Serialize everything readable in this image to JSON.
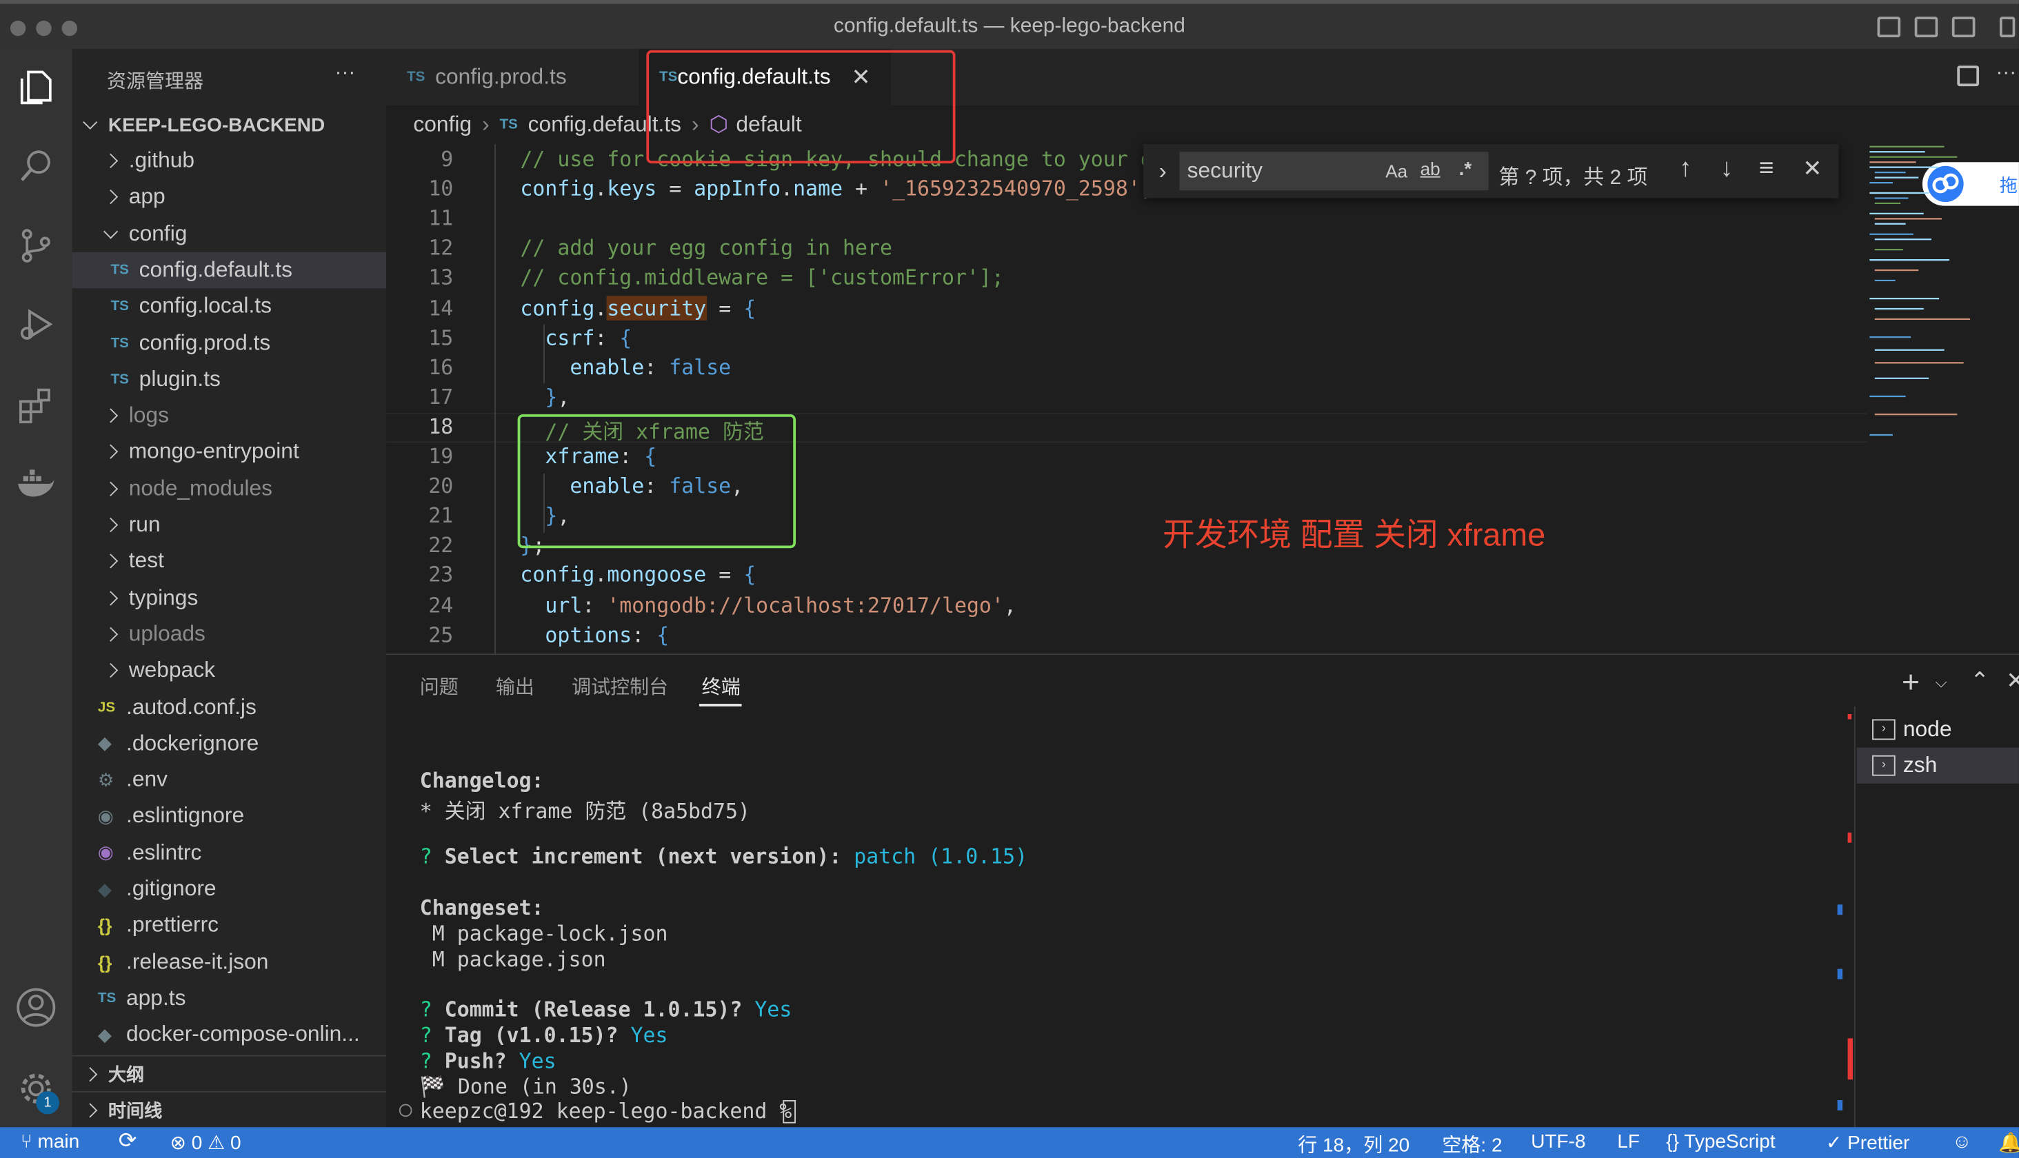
{
  "window": {
    "title": "config.default.ts — keep-lego-backend"
  },
  "sidebar": {
    "title": "资源管理器",
    "more": "···",
    "root": "KEEP-LEGO-BACKEND",
    "items": [
      {
        "label": ".github",
        "type": "folder"
      },
      {
        "label": "app",
        "type": "folder"
      },
      {
        "label": "config",
        "type": "folder-open"
      },
      {
        "label": "config.default.ts",
        "type": "ts"
      },
      {
        "label": "config.local.ts",
        "type": "ts"
      },
      {
        "label": "config.prod.ts",
        "type": "ts"
      },
      {
        "label": "plugin.ts",
        "type": "ts"
      },
      {
        "label": "logs",
        "type": "folder"
      },
      {
        "label": "mongo-entrypoint",
        "type": "folder"
      },
      {
        "label": "node_modules",
        "type": "folder"
      },
      {
        "label": "run",
        "type": "folder"
      },
      {
        "label": "test",
        "type": "folder"
      },
      {
        "label": "typings",
        "type": "folder"
      },
      {
        "label": "uploads",
        "type": "folder"
      },
      {
        "label": "webpack",
        "type": "folder"
      },
      {
        "label": ".autod.conf.js",
        "type": "js"
      },
      {
        "label": ".dockerignore",
        "type": "docker"
      },
      {
        "label": ".env",
        "type": "gear"
      },
      {
        "label": ".eslintignore",
        "type": "eslint-ignore"
      },
      {
        "label": ".eslintrc",
        "type": "eslint"
      },
      {
        "label": ".gitignore",
        "type": "git"
      },
      {
        "label": ".prettierrc",
        "type": "json"
      },
      {
        "label": ".release-it.json",
        "type": "json"
      },
      {
        "label": "app.ts",
        "type": "ts"
      },
      {
        "label": "docker-compose-onlin...",
        "type": "docker"
      }
    ],
    "outline": "大纲",
    "timeline": "时间线"
  },
  "tabs": [
    {
      "label": "config.prod.ts",
      "badge": "TS",
      "active": false
    },
    {
      "label": "config.default.ts",
      "badge": "TS",
      "active": true
    }
  ],
  "breadcrumb": {
    "folder": "config",
    "file": "config.default.ts",
    "symbol": "default",
    "badge": "TS"
  },
  "find": {
    "query": "security",
    "opt_case": "Aa",
    "opt_word": "ab",
    "opt_regex": ".*",
    "result": "第 ? 项，共 2 项"
  },
  "code": {
    "lines": [
      {
        "n": "9",
        "segs": [
          {
            "t": "// use for cookie sign key, should change to your own",
            "c": "c"
          }
        ]
      },
      {
        "n": "10",
        "segs": [
          {
            "t": "config",
            "c": "v"
          },
          {
            "t": ".",
            "c": "p"
          },
          {
            "t": "keys",
            "c": "v"
          },
          {
            "t": " = ",
            "c": "p"
          },
          {
            "t": "appInfo",
            "c": "v"
          },
          {
            "t": ".",
            "c": "p"
          },
          {
            "t": "name",
            "c": "v"
          },
          {
            "t": " + ",
            "c": "p"
          },
          {
            "t": "'_1659232540970_2598'",
            "c": "s"
          },
          {
            "t": ";",
            "c": "p"
          }
        ]
      },
      {
        "n": "11",
        "segs": []
      },
      {
        "n": "12",
        "segs": [
          {
            "t": "// add your egg config in here",
            "c": "c"
          }
        ]
      },
      {
        "n": "13",
        "segs": [
          {
            "t": "// config.middleware = ['customError'];",
            "c": "c"
          }
        ]
      },
      {
        "n": "14",
        "segs": [
          {
            "t": "config",
            "c": "v"
          },
          {
            "t": ".",
            "c": "p"
          },
          {
            "t": "security",
            "c": "v hl"
          },
          {
            "t": " = ",
            "c": "p"
          },
          {
            "t": "{",
            "c": "k"
          }
        ]
      },
      {
        "n": "15",
        "segs": [
          {
            "t": "  csrf",
            "c": "v"
          },
          {
            "t": ": ",
            "c": "p"
          },
          {
            "t": "{",
            "c": "k"
          }
        ]
      },
      {
        "n": "16",
        "segs": [
          {
            "t": "    enable",
            "c": "v"
          },
          {
            "t": ": ",
            "c": "p"
          },
          {
            "t": "false",
            "c": "k"
          }
        ]
      },
      {
        "n": "17",
        "segs": [
          {
            "t": "  }",
            "c": "k"
          },
          {
            "t": ",",
            "c": "p"
          }
        ]
      },
      {
        "n": "18",
        "segs": [
          {
            "t": "  // 关闭 xframe 防范",
            "c": "c"
          }
        ]
      },
      {
        "n": "19",
        "segs": [
          {
            "t": "  xframe",
            "c": "v"
          },
          {
            "t": ": ",
            "c": "p"
          },
          {
            "t": "{",
            "c": "k"
          }
        ]
      },
      {
        "n": "20",
        "segs": [
          {
            "t": "    enable",
            "c": "v"
          },
          {
            "t": ": ",
            "c": "p"
          },
          {
            "t": "false",
            "c": "k"
          },
          {
            "t": ",",
            "c": "p"
          }
        ]
      },
      {
        "n": "21",
        "segs": [
          {
            "t": "  }",
            "c": "k"
          },
          {
            "t": ",",
            "c": "p"
          }
        ]
      },
      {
        "n": "22",
        "segs": [
          {
            "t": "}",
            "c": "k"
          },
          {
            "t": ";",
            "c": "p"
          }
        ]
      },
      {
        "n": "23",
        "segs": [
          {
            "t": "config",
            "c": "v"
          },
          {
            "t": ".",
            "c": "p"
          },
          {
            "t": "mongoose",
            "c": "v"
          },
          {
            "t": " = ",
            "c": "p"
          },
          {
            "t": "{",
            "c": "k"
          }
        ]
      },
      {
        "n": "24",
        "segs": [
          {
            "t": "  url",
            "c": "v"
          },
          {
            "t": ": ",
            "c": "p"
          },
          {
            "t": "'mongodb://localhost:27017/lego'",
            "c": "s"
          },
          {
            "t": ",",
            "c": "p"
          }
        ]
      },
      {
        "n": "25",
        "segs": [
          {
            "t": "  options",
            "c": "v"
          },
          {
            "t": ": ",
            "c": "p"
          },
          {
            "t": "{",
            "c": "k"
          }
        ]
      }
    ],
    "current_line": "18"
  },
  "annotation": {
    "text": "开发环境 配置 关闭 xframe",
    "color": "#e8432e"
  },
  "panel": {
    "tabs": [
      "问题",
      "输出",
      "调试控制台",
      "终端"
    ],
    "active_tab": "终端",
    "terminals": [
      "node",
      "zsh"
    ],
    "lines": [
      {
        "segs": [
          {
            "t": "Changelog:",
            "c": "tb"
          }
        ]
      },
      {
        "segs": [
          {
            "t": "* 关闭 xframe 防范 (8a5bd75)",
            "c": ""
          }
        ]
      },
      {
        "segs": []
      },
      {
        "segs": [
          {
            "t": "? ",
            "c": "gn"
          },
          {
            "t": "Select increment (next version): ",
            "c": "tb"
          },
          {
            "t": "patch (1.0.15)",
            "c": "cy"
          }
        ]
      },
      {
        "segs": []
      },
      {
        "segs": [
          {
            "t": "Changeset:",
            "c": "tb"
          }
        ]
      },
      {
        "segs": [
          {
            "t": " M package-lock.json",
            "c": ""
          }
        ]
      },
      {
        "segs": [
          {
            "t": " M package.json",
            "c": ""
          }
        ]
      },
      {
        "segs": []
      },
      {
        "segs": [
          {
            "t": "? ",
            "c": "gn"
          },
          {
            "t": "Commit (Release 1.0.15)? ",
            "c": "tb"
          },
          {
            "t": "Yes",
            "c": "cy"
          }
        ]
      },
      {
        "segs": [
          {
            "t": "? ",
            "c": "gn"
          },
          {
            "t": "Tag (v1.0.15)? ",
            "c": "tb"
          },
          {
            "t": "Yes",
            "c": "cy"
          }
        ]
      },
      {
        "segs": [
          {
            "t": "? ",
            "c": "gn"
          },
          {
            "t": "Push? ",
            "c": "tb"
          },
          {
            "t": "Yes",
            "c": "cy"
          }
        ]
      },
      {
        "segs": [
          {
            "t": "🏁 Done (in 30s.)",
            "c": ""
          }
        ]
      },
      {
        "segs": [
          {
            "t": "keepzc@192 keep-lego-backend % ",
            "c": ""
          }
        ]
      }
    ]
  },
  "status": {
    "branch": "main",
    "errors": "0",
    "warnings": "0",
    "position": "行 18，列 20",
    "spaces": "空格: 2",
    "encoding": "UTF-8",
    "eol": "LF",
    "language": "TypeScript",
    "formatter": "Prettier",
    "settings_badge": "1"
  },
  "floating": {
    "label": "拖"
  },
  "colors": {
    "statusbar": "#2f74d0",
    "accent": "#0e639c",
    "annotation_red": "#e53935",
    "annotation_green": "#7ee05b"
  }
}
